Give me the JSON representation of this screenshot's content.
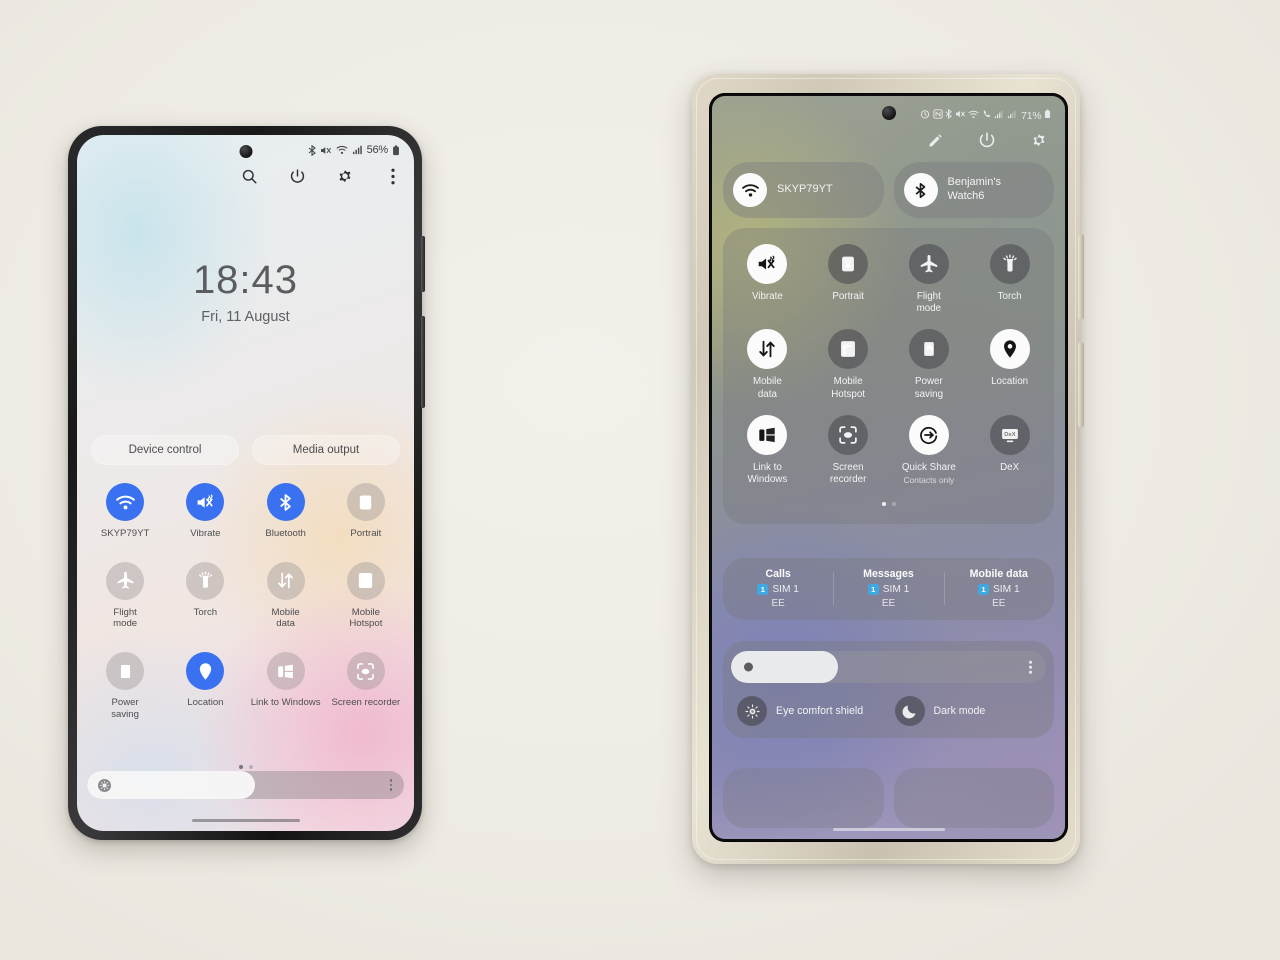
{
  "scene": {
    "background_color": "#f1eee8",
    "description": "Two Samsung Galaxy phones side by side showing Quick Settings panels"
  },
  "left_phone": {
    "name": "Galaxy S-series phone",
    "frame_color": "#1d1d1f",
    "status_bar": {
      "icons": [
        "bluetooth-icon",
        "vibrate-icon",
        "wifi-icon",
        "signal-icon"
      ],
      "battery_text": "56%",
      "battery_icon": "battery-icon"
    },
    "header_icons": [
      {
        "name": "search-icon",
        "glyph": "search"
      },
      {
        "name": "power-icon",
        "glyph": "power"
      },
      {
        "name": "settings-icon",
        "glyph": "gear"
      },
      {
        "name": "more-options-icon",
        "glyph": "kebab"
      }
    ],
    "clock": {
      "time": "18:43",
      "date": "Fri, 11 August"
    },
    "pills": [
      {
        "label": "Device control"
      },
      {
        "label": "Media output"
      }
    ],
    "tiles": [
      {
        "label": "SKYP79YT",
        "icon": "wifi-icon",
        "active": true
      },
      {
        "label": "Vibrate",
        "icon": "vibrate-icon",
        "active": true
      },
      {
        "label": "Bluetooth",
        "icon": "bluetooth-icon",
        "active": true
      },
      {
        "label": "Portrait",
        "icon": "screen-rotation-lock-icon",
        "active": false
      },
      {
        "label": "Flight\nmode",
        "icon": "airplane-icon",
        "active": false
      },
      {
        "label": "Torch",
        "icon": "flashlight-icon",
        "active": false
      },
      {
        "label": "Mobile\ndata",
        "icon": "mobile-data-icon",
        "active": false
      },
      {
        "label": "Mobile\nHotspot",
        "icon": "hotspot-icon",
        "active": false
      },
      {
        "label": "Power\nsaving",
        "icon": "power-saving-icon",
        "active": false
      },
      {
        "label": "Location",
        "icon": "location-pin-icon",
        "active": true
      },
      {
        "label": "Link to Windows",
        "icon": "link-to-windows-icon",
        "active": false
      },
      {
        "label": "Screen recorder",
        "icon": "screen-recorder-icon",
        "active": false
      }
    ],
    "page_dots": {
      "count": 2,
      "current": 1
    },
    "brightness": {
      "percent": 53,
      "icon": "brightness-icon",
      "more_icon": "kebab-icon"
    }
  },
  "right_phone": {
    "name": "Galaxy S-series Ultra phone in clear case",
    "case_color": "#ddd5bf",
    "status_bar": {
      "icons": [
        "alarm-icon",
        "nfc-icon",
        "bluetooth-icon",
        "vibrate-icon",
        "wifi-icon",
        "call-icon",
        "signal-icon",
        "signal2-icon"
      ],
      "battery_text": "71%",
      "battery_icon": "battery-icon"
    },
    "header_icons": [
      {
        "name": "edit-pencil-icon",
        "glyph": "pencil"
      },
      {
        "name": "power-icon",
        "glyph": "power"
      },
      {
        "name": "settings-icon",
        "glyph": "gear"
      }
    ],
    "connections": [
      {
        "label": "SKYP79YT",
        "icon": "wifi-icon",
        "active": true
      },
      {
        "label": "Benjamin's\nWatch6",
        "icon": "bluetooth-icon",
        "active": true
      }
    ],
    "tiles": [
      {
        "label": "Vibrate",
        "icon": "vibrate-icon",
        "active": true,
        "sub": ""
      },
      {
        "label": "Portrait",
        "icon": "screen-rotation-lock-icon",
        "active": false,
        "sub": ""
      },
      {
        "label": "Flight\nmode",
        "icon": "airplane-icon",
        "active": false,
        "sub": ""
      },
      {
        "label": "Torch",
        "icon": "flashlight-icon",
        "active": false,
        "sub": ""
      },
      {
        "label": "Mobile\ndata",
        "icon": "mobile-data-icon",
        "active": true,
        "sub": ""
      },
      {
        "label": "Mobile\nHotspot",
        "icon": "hotspot-icon",
        "active": false,
        "sub": ""
      },
      {
        "label": "Power\nsaving",
        "icon": "power-saving-icon",
        "active": false,
        "sub": ""
      },
      {
        "label": "Location",
        "icon": "location-pin-icon",
        "active": true,
        "sub": ""
      },
      {
        "label": "Link to\nWindows",
        "icon": "link-to-windows-icon",
        "active": true,
        "sub": ""
      },
      {
        "label": "Screen\nrecorder",
        "icon": "screen-recorder-icon",
        "active": false,
        "sub": ""
      },
      {
        "label": "Quick Share",
        "icon": "quick-share-icon",
        "active": true,
        "sub": "Contacts only"
      },
      {
        "label": "DeX",
        "icon": "dex-icon",
        "active": false,
        "sub": ""
      }
    ],
    "page_dots": {
      "count": 2,
      "current": 1
    },
    "sim_bar": [
      {
        "title": "Calls",
        "sim": "SIM 1",
        "badge": "1",
        "carrier": "EE"
      },
      {
        "title": "Messages",
        "sim": "SIM 1",
        "badge": "1",
        "carrier": "EE"
      },
      {
        "title": "Mobile data",
        "sim": "SIM 1",
        "badge": "1",
        "carrier": "EE"
      }
    ],
    "brightness": {
      "percent": 34,
      "more_icon": "kebab-icon"
    },
    "modes": [
      {
        "label": "Eye comfort shield",
        "icon": "eye-comfort-icon",
        "active": false
      },
      {
        "label": "Dark mode",
        "icon": "moon-icon",
        "active": false
      }
    ]
  }
}
